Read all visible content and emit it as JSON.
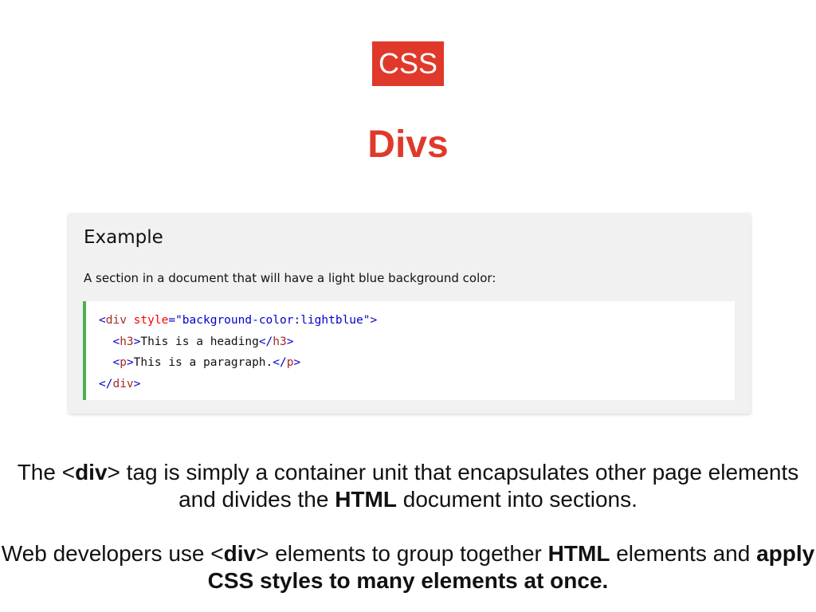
{
  "badge": {
    "text": "CSS",
    "color": "#e0392b"
  },
  "title": "Divs",
  "example": {
    "heading": "Example",
    "description": "A section in a document that will have a light blue background color:",
    "accent_color": "#4caf50",
    "code": {
      "line1": {
        "open_lt": "<",
        "tag": "div",
        "space": " ",
        "attr": "style",
        "eq": "=",
        "value": "\"background-color:lightblue\"",
        "close_gt": ">"
      },
      "line2": {
        "indent": "  ",
        "open_lt": "<",
        "tag": "h3",
        "open_gt": ">",
        "text": "This is a heading",
        "close_lt": "</",
        "close_tag": "h3",
        "close_gt": ">"
      },
      "line3": {
        "indent": "  ",
        "open_lt": "<",
        "tag": "p",
        "open_gt": ">",
        "text": "This is a paragraph.",
        "close_lt": "</",
        "close_tag": "p",
        "close_gt": ">"
      },
      "line4": {
        "close_lt": "</",
        "tag": "div",
        "close_gt": ">"
      }
    }
  },
  "paragraph1": {
    "part1": "The <",
    "bold1": "div",
    "part2": "> tag is simply a container unit that encapsulates other page elements and divides the ",
    "bold2": "HTML",
    "part3": " document into sections."
  },
  "paragraph2": {
    "part1": "Web developers use <",
    "bold1": "div",
    "part2": "> elements to group together ",
    "bold2": "HTML",
    "part3": " elements and ",
    "bold3": "apply CSS styles to many elements at once."
  }
}
